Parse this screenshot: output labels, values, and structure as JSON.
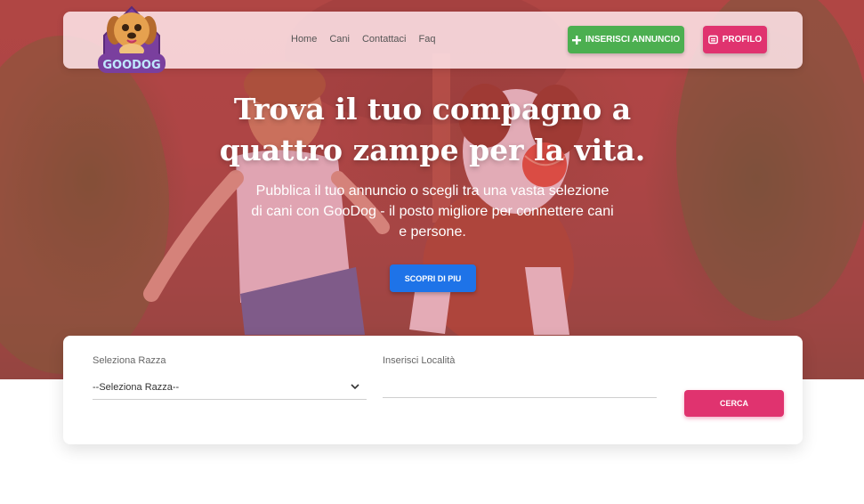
{
  "brand": {
    "logo_text": "GOODOG"
  },
  "nav": {
    "links": [
      "Home",
      "Cani",
      "Contattaci",
      "Faq"
    ],
    "annuncio_label": "INSERISCI ANNUNCIO",
    "profilo_label": "PROFILO"
  },
  "hero": {
    "title_line1": "Trova il tuo compagno a",
    "title_line2": "quattro zampe per la vita.",
    "subtitle": "Pubblica il tuo annuncio o scegli tra una vasta selezione di cani con GooDog - il posto migliore per connettere cani e persone.",
    "cta_label": "SCOPRI DI PIU"
  },
  "search": {
    "breed_label": "Seleziona Razza",
    "breed_value": "--Seleziona Razza--",
    "location_label": "Inserisci Località",
    "location_value": "",
    "submit_label": "CERCA"
  },
  "colors": {
    "green": "#4caf50",
    "pink": "#e0336f",
    "blue": "#1e73e8"
  }
}
